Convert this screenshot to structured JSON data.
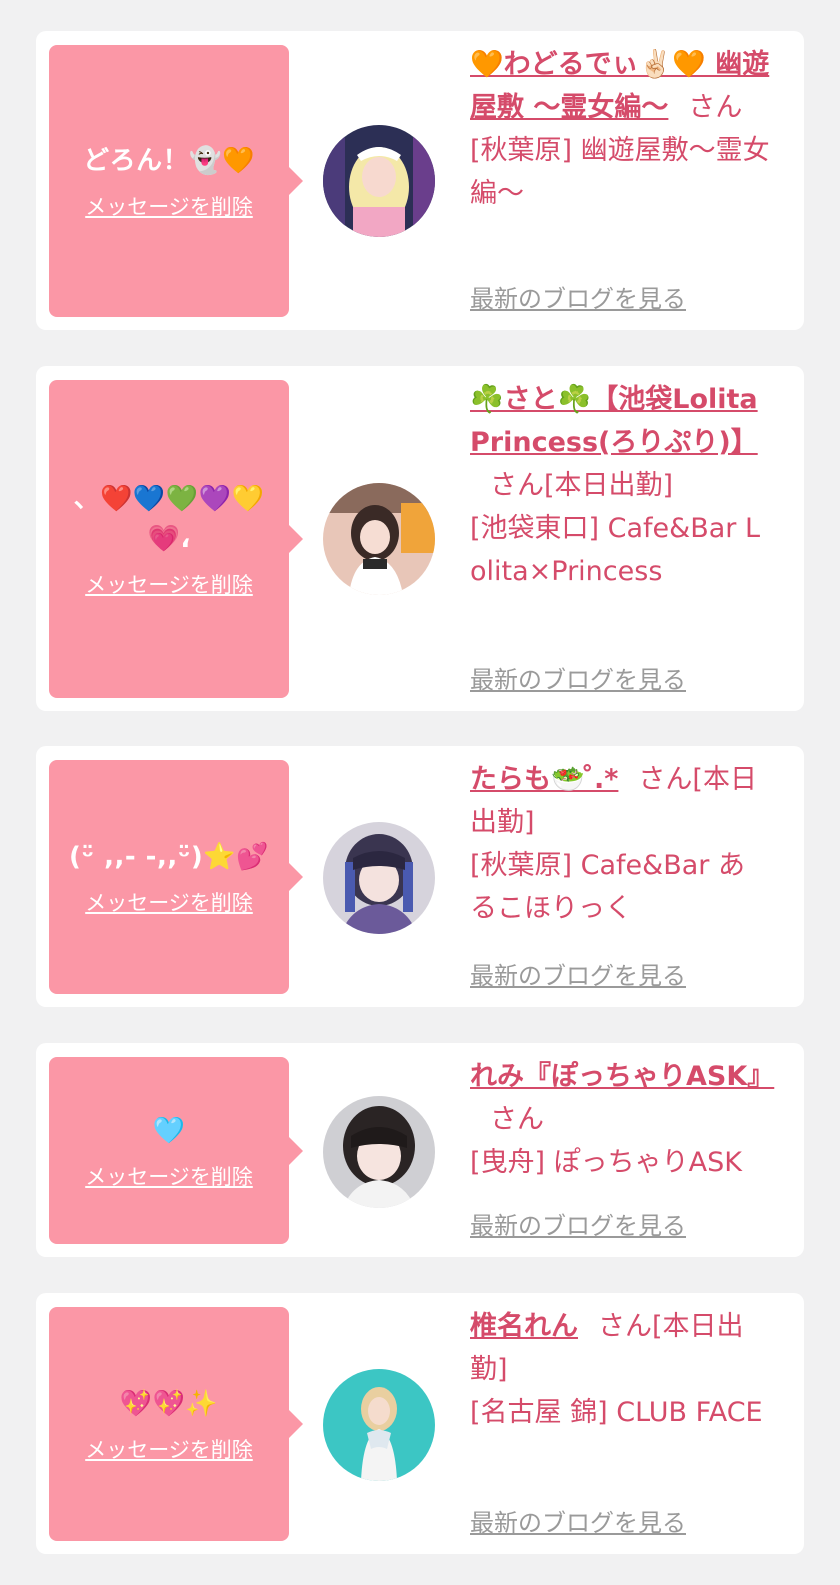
{
  "cards": [
    {
      "message": "どろん！👻🧡",
      "delete_label": "メッセージを削除",
      "name": "🧡わどるでぃ✌🏻🧡 幽遊屋敷 〜霊女編〜",
      "san": "さん",
      "shop": "[秋葉原] 幽遊屋敷〜霊女編〜",
      "blog_label": "最新のブログを見る"
    },
    {
      "message": "、❤️💙💚💜💛💗،",
      "delete_label": "メッセージを削除",
      "name": "☘️さと☘️【池袋LolitaPrincess(ろりぷり)】",
      "san": "さん[本日出勤]",
      "shop": "[池袋東口] Cafe&Bar Lolita×Princess",
      "blog_label": "最新のブログを見る"
    },
    {
      "message": "(ᵕ̈ ,,- -,,ᵕ̈)⭐💕",
      "delete_label": "メッセージを削除",
      "name": "たらも🥗 ̊.*",
      "san": "さん[本日出勤]",
      "shop": "[秋葉原] Cafe&Bar あるこほりっく",
      "blog_label": "最新のブログを見る"
    },
    {
      "message": "🩵",
      "delete_label": "メッセージを削除",
      "name": "れみ『ぽっちゃりASK』",
      "san": "さん",
      "shop": "[曳舟] ぽっちゃりASK",
      "blog_label": "最新のブログを見る"
    },
    {
      "message": "💖💖✨",
      "delete_label": "メッセージを削除",
      "name": "椎名れん",
      "san": "さん[本日出勤]",
      "shop": "[名古屋 錦] CLUB FACE",
      "blog_label": "最新のブログを見る"
    }
  ],
  "colors": {
    "page_bg": "#f1f1f2",
    "bubble": "#fb97a6",
    "text_pink": "#d54b6a",
    "link_gray": "#9a9a9a"
  }
}
